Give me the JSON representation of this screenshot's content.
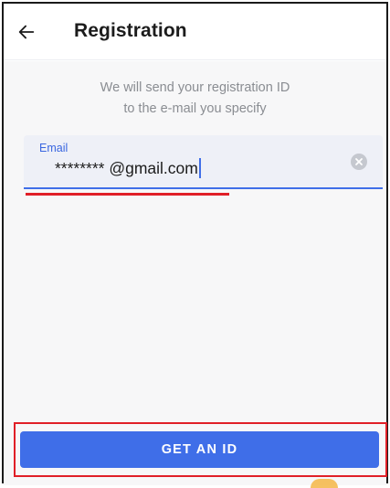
{
  "header": {
    "title": "Registration",
    "back_icon": "arrow-left-icon"
  },
  "message": {
    "line1": "We will send your registration ID",
    "line2": "to the e-mail you specify"
  },
  "email_field": {
    "label": "Email",
    "value": "******** @gmail.com",
    "clear_icon": "clear-circle-icon"
  },
  "actions": {
    "get_id_label": "GET AN ID"
  },
  "colors": {
    "accent": "#3f6ee8",
    "annotation": "#e01f27",
    "field_bg": "#eef0f7",
    "text_secondary": "#8a8d92"
  }
}
